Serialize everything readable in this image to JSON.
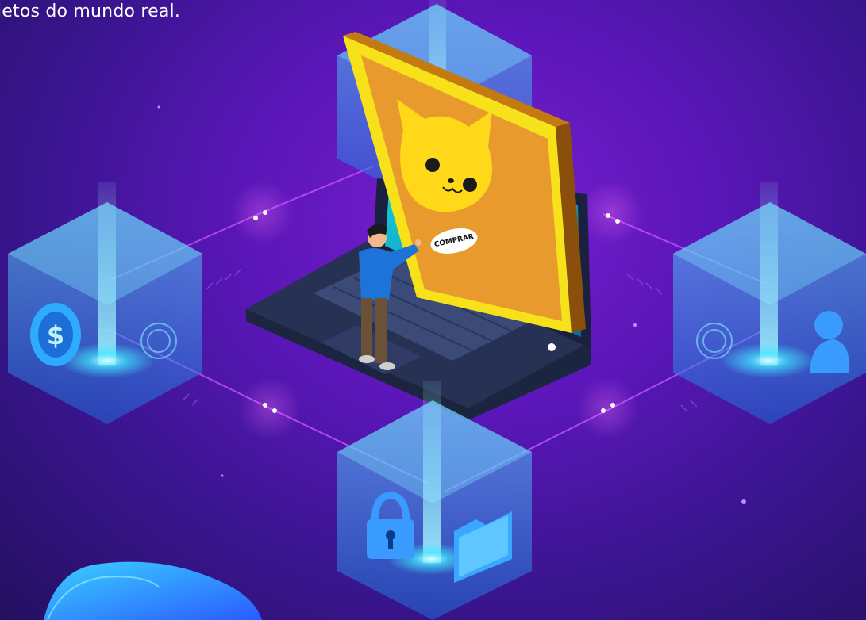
{
  "caption": "jetos do mundo real.",
  "product_card": {
    "buy_button_label": "COMPRAR"
  },
  "icons": {
    "coin": "dollar-coin-icon",
    "user": "user-icon",
    "lock": "padlock-icon",
    "folder": "folder-icon",
    "cat": "cat-face-icon"
  },
  "colors": {
    "background": "#5a16b8",
    "cube_glow": "#2fe0ff",
    "card_frame": "#f7e11a",
    "card_face": "#e89a2c",
    "cat": "#ffd81a",
    "laptop": "#1c2540"
  }
}
